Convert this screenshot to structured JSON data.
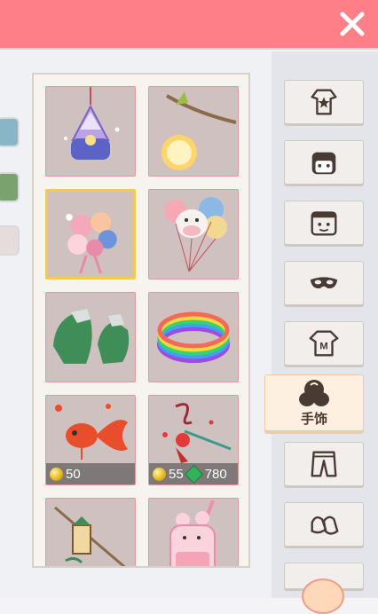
{
  "header": {
    "close_icon": "close-x-icon"
  },
  "colors": {
    "header": "#ff7f88",
    "selected_border": "#f5c84e",
    "card_bg": "#cfc1c0"
  },
  "side_tabs": [
    {
      "color": "#88b6c6"
    },
    {
      "color": "#7aa26e"
    },
    {
      "color": "#e6dcdc"
    }
  ],
  "items": [
    {
      "name": "furin-chime-ornament",
      "price": null
    },
    {
      "name": "moon-lantern-branch",
      "price": null
    },
    {
      "name": "flower-bouquet",
      "price": null,
      "selected": true
    },
    {
      "name": "cow-balloons",
      "price": null
    },
    {
      "name": "green-gauntlets",
      "price": null
    },
    {
      "name": "rainbow-bangles",
      "price": null
    },
    {
      "name": "goldfish-charm",
      "price": {
        "coins": "50"
      }
    },
    {
      "name": "rose-wand",
      "price": {
        "coins": "55",
        "gems": "780"
      }
    },
    {
      "name": "lantern-pole",
      "price": null
    },
    {
      "name": "bunny-cup",
      "price": null
    }
  ],
  "categories": [
    {
      "icon": "outfit-icon",
      "label": ""
    },
    {
      "icon": "hair-icon",
      "label": ""
    },
    {
      "icon": "face-icon",
      "label": ""
    },
    {
      "icon": "mask-icon",
      "label": ""
    },
    {
      "icon": "shirt-icon",
      "label": ""
    },
    {
      "icon": "hand-accessory-icon",
      "label": "手饰",
      "active": true
    },
    {
      "icon": "pants-icon",
      "label": ""
    },
    {
      "icon": "shoes-icon",
      "label": ""
    }
  ],
  "prices": {
    "goldfish_coins": "50",
    "wand_coins": "55",
    "wand_gems": "780"
  },
  "labels": {
    "active_category": "手饰"
  }
}
